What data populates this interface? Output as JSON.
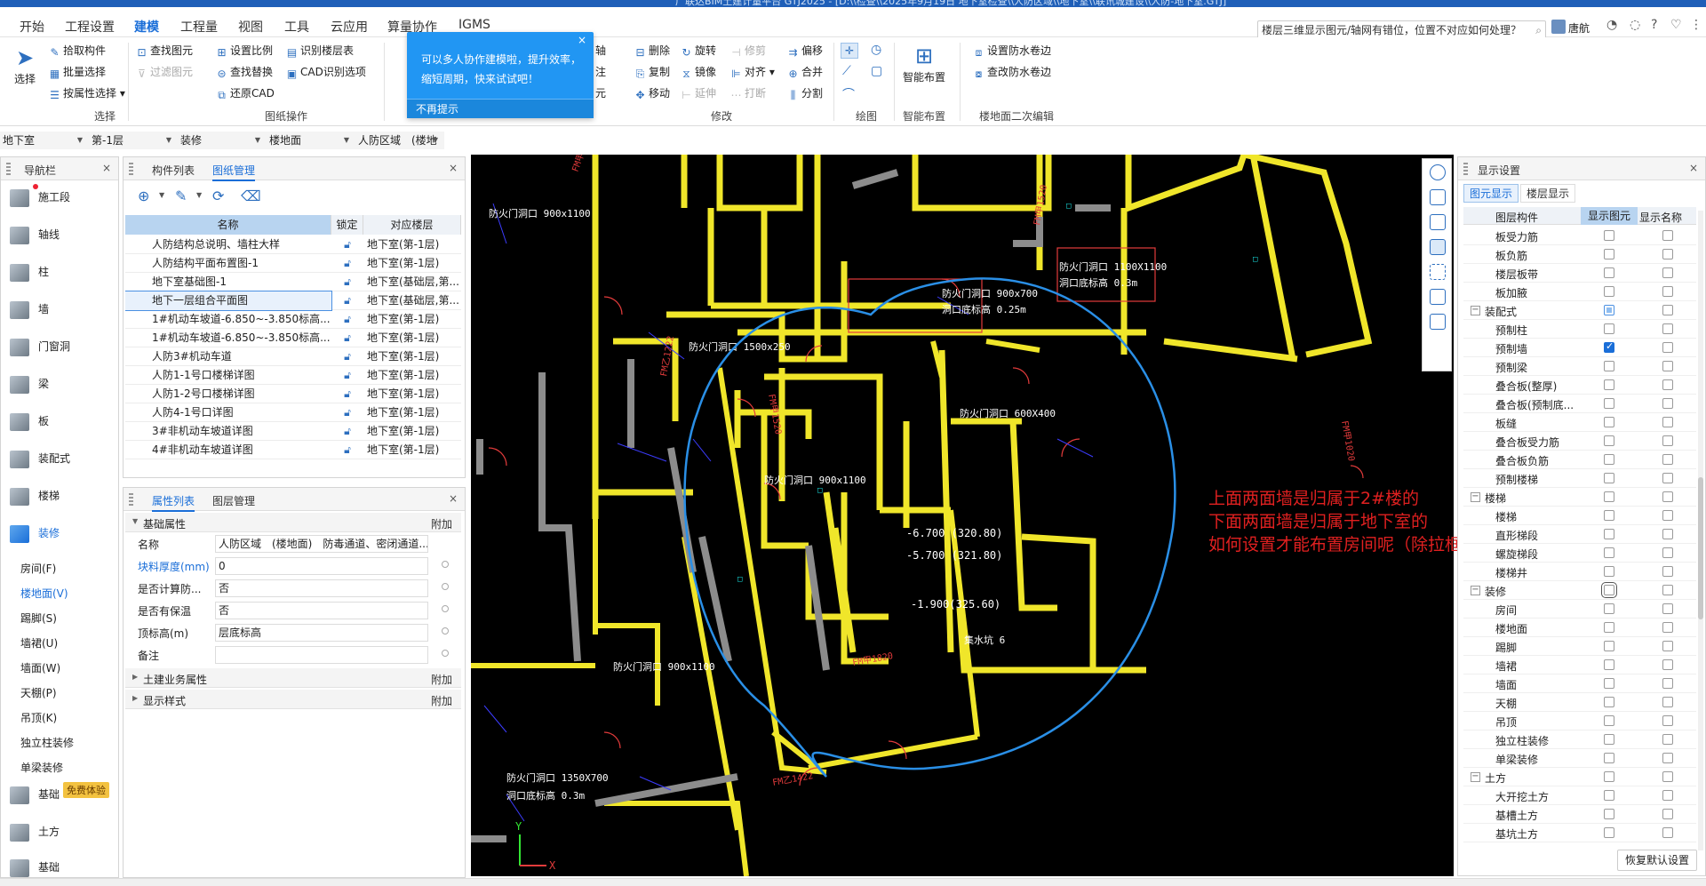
{
  "window": {
    "title": "广联达BIM土建计量平台 GTJ2025 - [D:\\\\检查\\\\2025年9月19日 地下室检查\\\\人防区域\\\\地下室\\\\联讯城建设\\\\人防-地下室.GTJ]"
  },
  "menu": [
    "开始",
    "工程设置",
    "建模",
    "工程量",
    "视图",
    "工具",
    "云应用",
    "算量协作",
    "IGMS"
  ],
  "menu_active": "建模",
  "question_search": "楼层三维显示图元/轴网有错位，位置不对应如何处理？",
  "user_name": "唐航",
  "ribbon": {
    "select_group": {
      "big_label": "选择",
      "items": [
        "拾取构件",
        "批量选择",
        "按属性选择"
      ],
      "group_label": "选择"
    },
    "drawing_group": {
      "items": [
        "查找图元",
        "过滤图元",
        "设置比例",
        "查找替换",
        "还原CAD",
        "识别楼层表",
        "CAD识别选项"
      ],
      "group_label": "图纸操作"
    },
    "modify_group": {
      "items": [
        "删除",
        "旋转",
        "修剪",
        "偏移",
        "复制",
        "镜像",
        "对齐",
        "合并",
        "移动",
        "延伸",
        "打断",
        "分割"
      ],
      "partial": [
        "轴",
        "注",
        "元"
      ],
      "group_label": "修改"
    },
    "draw_group": {
      "group_label": "绘图"
    },
    "smart_group": {
      "big_label": "智能布置",
      "group_label": "智能布置"
    },
    "floor_group": {
      "items": [
        "设置防水卷边",
        "查改防水卷边"
      ],
      "group_label": "楼地面二次编辑"
    }
  },
  "popup": {
    "message": "可以多人协作建模啦，提升效率，缩短周期，快来试试吧！",
    "dismiss": "不再提示",
    "close": "×"
  },
  "selectors": [
    "地下室",
    "第-1层",
    "装修",
    "楼地面",
    "人防区域　(楼地"
  ],
  "nav": {
    "title": "导航栏",
    "items": [
      "施工段",
      "轴线",
      "柱",
      "墙",
      "门窗洞",
      "梁",
      "板",
      "装配式",
      "楼梯",
      "装修"
    ],
    "active": "装修",
    "sub_items": [
      "房间(F)",
      "楼地面(V)",
      "踢脚(S)",
      "墙裙(U)",
      "墙面(W)",
      "天棚(P)",
      "吊顶(K)",
      "独立柱装修",
      "单梁装修"
    ],
    "sub_active": "楼地面(V)",
    "bottom_items": [
      "基础",
      "土方",
      "基础"
    ],
    "free_badge": "免费体验"
  },
  "drawing_panel": {
    "tabs": [
      "构件列表",
      "图纸管理"
    ],
    "active_tab": "图纸管理",
    "columns": [
      "名称",
      "锁定",
      "对应楼层"
    ],
    "rows": [
      {
        "name": "人防结构总说明、墙柱大样",
        "floor": "地下室(第-1层)"
      },
      {
        "name": "人防结构平面布置图-1",
        "floor": "地下室(第-1层)"
      },
      {
        "name": "地下室基础图-1",
        "floor": "地下室(基础层,第..."
      },
      {
        "name": "地下一层组合平面图",
        "floor": "地下室(基础层,第..."
      },
      {
        "name": "1#机动车坡道-6.850~-3.850标高...",
        "floor": "地下室(第-1层)"
      },
      {
        "name": "1#机动车坡道-6.850~-3.850标高...",
        "floor": "地下室(第-1层)"
      },
      {
        "name": "人防3#机动车道",
        "floor": "地下室(第-1层)"
      },
      {
        "name": "人防1-1号口楼梯详图",
        "floor": "地下室(第-1层)"
      },
      {
        "name": "人防1-2号口楼梯详图",
        "floor": "地下室(第-1层)"
      },
      {
        "name": "人防4-1号口详图",
        "floor": "地下室(第-1层)"
      },
      {
        "name": "3#非机动车坡道详图",
        "floor": "地下室(第-1层)"
      },
      {
        "name": "4#非机动车坡道详图",
        "floor": "地下室(第-1层)"
      }
    ],
    "selected_row": 3
  },
  "property_panel": {
    "tabs": [
      "属性列表",
      "图层管理"
    ],
    "section_basic": "基础属性",
    "attach": "附加",
    "rows": [
      {
        "label": "名称",
        "value": "人防区域　(楼地面)　防毒通道、密闭通道..."
      },
      {
        "label": "块料厚度(mm)",
        "value": "0"
      },
      {
        "label": "是否计算防...",
        "value": "否"
      },
      {
        "label": "是否有保温",
        "value": "否"
      },
      {
        "label": "顶标高(m)",
        "value": "层底标高"
      },
      {
        "label": "备注",
        "value": ""
      }
    ],
    "section_civil": "土建业务属性",
    "section_display": "显示样式"
  },
  "display_panel": {
    "title": "显示设置",
    "tabs": [
      "图元显示",
      "楼层显示"
    ],
    "columns": [
      "图层构件",
      "显示图元",
      "显示名称"
    ],
    "rows": [
      {
        "name": "板受力筋",
        "level": 2,
        "show": false,
        "label": false
      },
      {
        "name": "板负筋",
        "level": 2,
        "show": false,
        "label": false
      },
      {
        "name": "楼层板带",
        "level": 2,
        "show": false,
        "label": false
      },
      {
        "name": "板加腋",
        "level": 2,
        "show": false,
        "label": false
      },
      {
        "name": "装配式",
        "level": 1,
        "show": "partial",
        "label": false
      },
      {
        "name": "预制柱",
        "level": 2,
        "show": false,
        "label": false
      },
      {
        "name": "预制墙",
        "level": 2,
        "show": true,
        "label": false
      },
      {
        "name": "预制梁",
        "level": 2,
        "show": false,
        "label": false
      },
      {
        "name": "叠合板(整厚)",
        "level": 2,
        "show": false,
        "label": false
      },
      {
        "name": "叠合板(预制底...",
        "level": 2,
        "show": false,
        "label": false
      },
      {
        "name": "板缝",
        "level": 2,
        "show": false,
        "label": false
      },
      {
        "name": "叠合板受力筋",
        "level": 2,
        "show": false,
        "label": false
      },
      {
        "name": "叠合板负筋",
        "level": 2,
        "show": false,
        "label": false
      },
      {
        "name": "预制楼梯",
        "level": 2,
        "show": false,
        "label": false
      },
      {
        "name": "楼梯",
        "level": 1,
        "show": false,
        "label": false
      },
      {
        "name": "楼梯",
        "level": 2,
        "show": false,
        "label": false
      },
      {
        "name": "直形梯段",
        "level": 2,
        "show": false,
        "label": false
      },
      {
        "name": "螺旋梯段",
        "level": 2,
        "show": false,
        "label": false
      },
      {
        "name": "楼梯井",
        "level": 2,
        "show": false,
        "label": false
      },
      {
        "name": "装修",
        "level": 1,
        "show": false,
        "label": false
      },
      {
        "name": "房间",
        "level": 2,
        "show": false,
        "label": false
      },
      {
        "name": "楼地面",
        "level": 2,
        "show": false,
        "label": false
      },
      {
        "name": "踢脚",
        "level": 2,
        "show": false,
        "label": false
      },
      {
        "name": "墙裙",
        "level": 2,
        "show": false,
        "label": false
      },
      {
        "name": "墙面",
        "level": 2,
        "show": false,
        "label": false
      },
      {
        "name": "天棚",
        "level": 2,
        "show": false,
        "label": false
      },
      {
        "name": "吊顶",
        "level": 2,
        "show": false,
        "label": false
      },
      {
        "name": "独立柱装修",
        "level": 2,
        "show": false,
        "label": false
      },
      {
        "name": "单梁装修",
        "level": 2,
        "show": false,
        "label": false
      },
      {
        "name": "土方",
        "level": 1,
        "show": false,
        "label": false
      },
      {
        "name": "大开挖土方",
        "level": 2,
        "show": false,
        "label": false
      },
      {
        "name": "基槽土方",
        "level": 2,
        "show": false,
        "label": false
      },
      {
        "name": "基坑土方",
        "level": 2,
        "show": false,
        "label": false
      }
    ],
    "restore": "恢复默认设置"
  },
  "annotation": {
    "lines": [
      "上面两面墙是归属于2#楼的",
      "下面两面墙是归属于地下室的",
      "如何设置才能布置房间呢（除拉框布置外）"
    ],
    "color": "#e02020"
  },
  "cad_labels": {
    "openings": [
      "防火门洞口 900x1100",
      "防火门洞口 900x700",
      "防火门洞口 1100X1100",
      "防火门洞口 1500x250",
      "防火门洞口 600X400",
      "防火门洞口 1350X700"
    ],
    "notes": [
      "洞口底标高 0.25m",
      "洞口底标高 0.3m",
      "-6.700 (320.80)",
      "-5.700 (321.80)",
      "-1.900(325.60)",
      "集水坑 6"
    ],
    "doors": [
      "FM甲1520",
      "FM甲1020",
      "FM乙1222",
      "FM甲1820",
      "FM乙1422"
    ]
  },
  "colors": {
    "accent": "#1a6ed8",
    "canvas": "#000000",
    "wall_yellow": "#f0e62a",
    "wall_gray": "#8c8c8c",
    "circle_blue": "#2a8fe6",
    "cad_cyan": "#19e6e6"
  }
}
